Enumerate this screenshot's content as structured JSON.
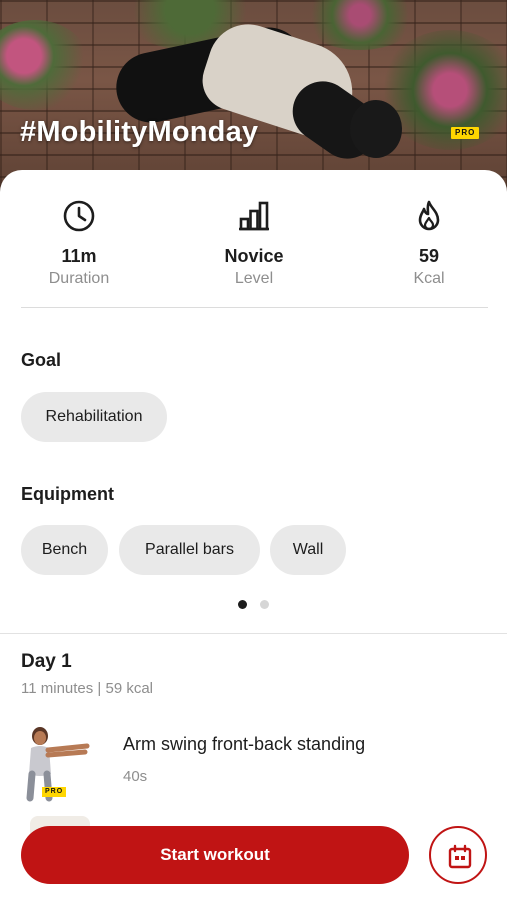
{
  "hero": {
    "title": "#MobilityMonday",
    "badge": "PRO"
  },
  "stats": [
    {
      "icon": "clock-icon",
      "value": "11m",
      "label": "Duration"
    },
    {
      "icon": "level-bars-icon",
      "value": "Novice",
      "label": "Level"
    },
    {
      "icon": "flame-icon",
      "value": "59",
      "label": "Kcal"
    }
  ],
  "goal": {
    "title": "Goal",
    "chips": [
      "Rehabilitation"
    ]
  },
  "equipment": {
    "title": "Equipment",
    "chips": [
      "Bench",
      "Parallel bars",
      "Wall"
    ]
  },
  "pager": {
    "pages": 2,
    "active": 1
  },
  "day": {
    "title": "Day 1",
    "meta": "11 minutes | 59 kcal"
  },
  "exercises": [
    {
      "name": "Arm swing front-back standing",
      "duration": "40s",
      "badge": "PRO"
    }
  ],
  "actions": {
    "start_label": "Start workout",
    "calendar_icon": "calendar-icon"
  },
  "colors": {
    "accent": "#c01414",
    "pro_badge": "#ffd600",
    "chip_bg": "#e9e9e9",
    "muted_text": "#8e8e8e"
  }
}
